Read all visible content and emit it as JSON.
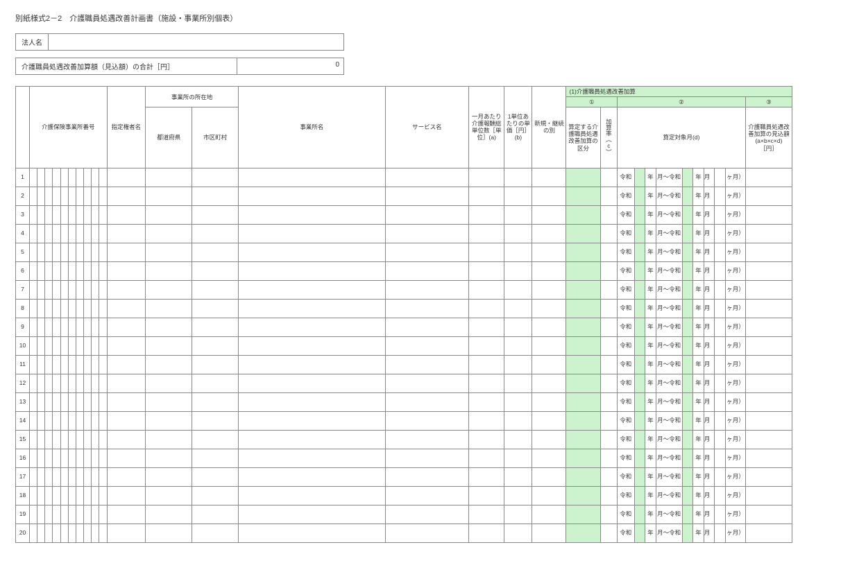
{
  "title": "別紙様式2－2　介護職員処遇改善計画書（施設・事業所別個表）",
  "legal": {
    "label": "法人名",
    "value": ""
  },
  "total": {
    "label": "介護職員処遇改善加算額（見込額）の合計［円］",
    "value": "0"
  },
  "headers": {
    "num": "",
    "office_no": "介護保険事業所番号",
    "authority": "指定権者名",
    "location": "事業所の所在地",
    "pref": "都道府県",
    "city": "市区町村",
    "office_name": "事業所名",
    "service": "サービス名",
    "monthly_units": "一月あたり介護報酬総単位数［単位］(a)",
    "unit_price": "1単位あたりの単価［円］(b)",
    "section1": "(1)介護職員処遇改善加算",
    "col1": "①",
    "col2": "②",
    "col3": "③",
    "new_cont": "新規・継続の別",
    "category": "算定する介護職員処遇改善加算の区分",
    "rate": "加算率（c）",
    "months": "算定対象月(d)",
    "amount": "介護職員処遇改善加算の見込額\n(a×b×c×d)\n［円］"
  },
  "date_template": {
    "reiwa": "令和",
    "year": "年",
    "month_to_reiwa": "月～令和",
    "month_open": "月（",
    "months_close": "ヶ月）"
  },
  "rows": [
    {
      "num": "1"
    },
    {
      "num": "2"
    },
    {
      "num": "3"
    },
    {
      "num": "4"
    },
    {
      "num": "5"
    },
    {
      "num": "6"
    },
    {
      "num": "7"
    },
    {
      "num": "8"
    },
    {
      "num": "9"
    },
    {
      "num": "10"
    },
    {
      "num": "11"
    },
    {
      "num": "12"
    },
    {
      "num": "13"
    },
    {
      "num": "14"
    },
    {
      "num": "15"
    },
    {
      "num": "16"
    },
    {
      "num": "17"
    },
    {
      "num": "18"
    },
    {
      "num": "19"
    },
    {
      "num": "20"
    }
  ]
}
